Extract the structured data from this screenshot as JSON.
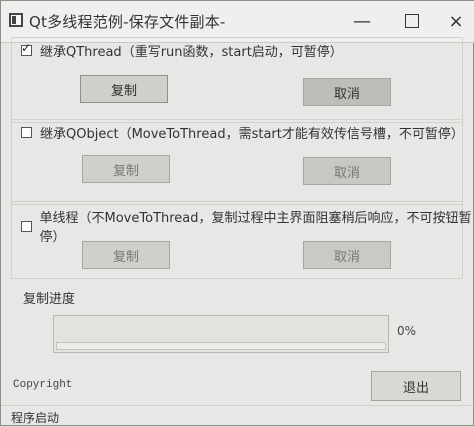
{
  "window": {
    "title": "Qt多线程范例-保存文件副本-"
  },
  "options": [
    {
      "label": "继承QThread（重写run函数，start启动，可暂停）",
      "checked": true,
      "copy_label": "复制",
      "cancel_label": "取消"
    },
    {
      "label": "继承QObject（MoveToThread，需start才能有效传信号槽，不可暂停）",
      "checked": false,
      "copy_label": "复制",
      "cancel_label": "取消"
    },
    {
      "label": "单线程（不MoveToThread，复制过程中主界面阻塞稍后响应，不可按钮暂停）",
      "checked": false,
      "copy_label": "复制",
      "cancel_label": "取消"
    }
  ],
  "progress": {
    "label": "复制进度",
    "value_percent": 0,
    "text": "0%"
  },
  "footer": {
    "copyright": "Copyright",
    "exit_label": "退出"
  },
  "status": {
    "text": "程序启动"
  }
}
